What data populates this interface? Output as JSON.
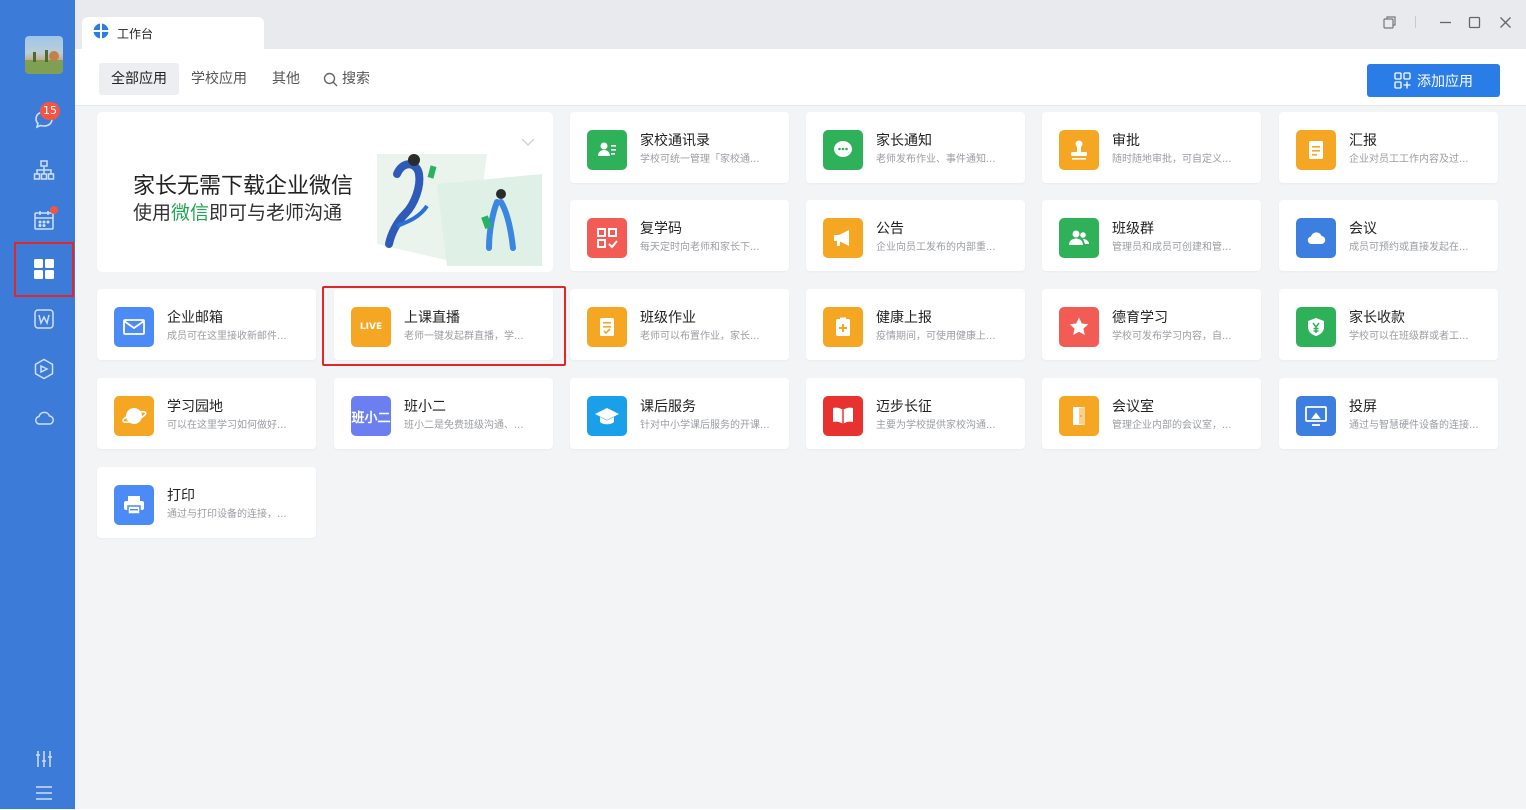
{
  "sidebar": {
    "chat_badge": "15",
    "items": [
      {
        "name": "chat-icon"
      },
      {
        "name": "org-chart-icon"
      },
      {
        "name": "calendar-icon"
      },
      {
        "name": "workbench-icon"
      },
      {
        "name": "doc-w-icon"
      },
      {
        "name": "box-icon"
      },
      {
        "name": "cloud-icon"
      }
    ],
    "bottom": [
      {
        "name": "settings-sliders-icon"
      },
      {
        "name": "menu-icon"
      }
    ]
  },
  "tab": {
    "label": "工作台"
  },
  "filters": [
    {
      "label": "全部应用",
      "active": true
    },
    {
      "label": "学校应用",
      "active": false
    },
    {
      "label": "其他",
      "active": false
    },
    {
      "label": "搜索",
      "active": false
    }
  ],
  "add_button": "添加应用",
  "banner": {
    "line1": "家长无需下载企业微信",
    "line2_prefix": "使用",
    "line2_highlight": "微信",
    "line2_suffix": "即可与老师沟通"
  },
  "apps": [
    {
      "title": "家校通讯录",
      "desc": "学校可统一管理「家校通...",
      "color": "#2fb15a",
      "icon": "contacts-icon"
    },
    {
      "title": "家长通知",
      "desc": "老师发布作业、事件通知...",
      "color": "#2fb15a",
      "icon": "message-icon"
    },
    {
      "title": "审批",
      "desc": "随时随地审批，可自定义...",
      "color": "#f5a623",
      "icon": "stamp-icon"
    },
    {
      "title": "汇报",
      "desc": "企业对员工工作内容及过...",
      "color": "#f5a623",
      "icon": "report-icon"
    },
    {
      "title": "复学码",
      "desc": "每天定时向老师和家长下...",
      "color": "#f25c54",
      "icon": "qr-check-icon"
    },
    {
      "title": "公告",
      "desc": "企业向员工发布的内部重...",
      "color": "#f5a623",
      "icon": "megaphone-icon"
    },
    {
      "title": "班级群",
      "desc": "管理员和成员可创建和管...",
      "color": "#2fb15a",
      "icon": "group-icon"
    },
    {
      "title": "会议",
      "desc": "成员可预约或直接发起在...",
      "color": "#3d7fe0",
      "icon": "meeting-cloud-icon"
    },
    {
      "title": "企业邮箱",
      "desc": "成员可在这里接收新邮件...",
      "color": "#4c8bf5",
      "icon": "mail-icon"
    },
    {
      "title": "上课直播",
      "desc": "老师一键发起群直播，学...",
      "color": "#f5a623",
      "icon": "live-icon",
      "icon_text": "LIVE"
    },
    {
      "title": "班级作业",
      "desc": "老师可以布置作业，家长...",
      "color": "#f5a623",
      "icon": "homework-icon"
    },
    {
      "title": "健康上报",
      "desc": "疫情期间，可使用健康上...",
      "color": "#f5a623",
      "icon": "health-report-icon"
    },
    {
      "title": "德育学习",
      "desc": "学校可发布学习内容，自...",
      "color": "#f25c54",
      "icon": "star-icon"
    },
    {
      "title": "家长收款",
      "desc": "学校可以在班级群或者工...",
      "color": "#2fb15a",
      "icon": "yuan-icon"
    },
    {
      "title": "学习园地",
      "desc": "可以在这里学习如何做好...",
      "color": "#f5a623",
      "icon": "planet-icon"
    },
    {
      "title": "班小二",
      "desc": "班小二是免费班级沟通、...",
      "color": "#6b7ff0",
      "icon": "banxiaoer-icon",
      "icon_text": "班小二"
    },
    {
      "title": "课后服务",
      "desc": "针对中小学课后服务的开课...",
      "color": "#1aa0e8",
      "icon": "graduation-cap-icon"
    },
    {
      "title": "迈步长征",
      "desc": "主要为学校提供家校沟通...",
      "color": "#e8322f",
      "icon": "book-icon"
    },
    {
      "title": "会议室",
      "desc": "管理企业内部的会议室，...",
      "color": "#f5a623",
      "icon": "door-icon"
    },
    {
      "title": "投屏",
      "desc": "通过与智慧硬件设备的连接...",
      "color": "#3d7fe0",
      "icon": "screen-cast-icon"
    },
    {
      "title": "打印",
      "desc": "通过与打印设备的连接，...",
      "color": "#4c8bf5",
      "icon": "printer-icon"
    }
  ]
}
